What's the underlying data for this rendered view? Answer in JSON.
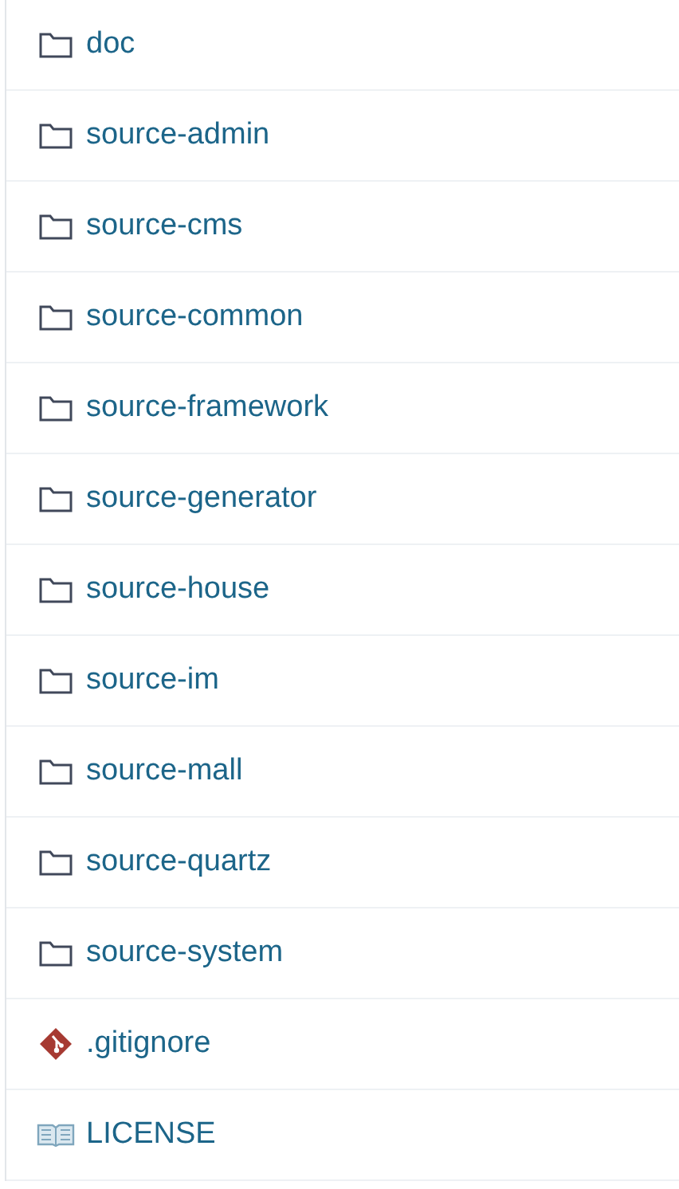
{
  "files": [
    {
      "kind": "folder",
      "name": "doc"
    },
    {
      "kind": "folder",
      "name": "source-admin"
    },
    {
      "kind": "folder",
      "name": "source-cms"
    },
    {
      "kind": "folder",
      "name": "source-common"
    },
    {
      "kind": "folder",
      "name": "source-framework"
    },
    {
      "kind": "folder",
      "name": "source-generator"
    },
    {
      "kind": "folder",
      "name": "source-house"
    },
    {
      "kind": "folder",
      "name": "source-im"
    },
    {
      "kind": "folder",
      "name": "source-mall"
    },
    {
      "kind": "folder",
      "name": "source-quartz"
    },
    {
      "kind": "folder",
      "name": "source-system"
    },
    {
      "kind": "git",
      "name": ".gitignore"
    },
    {
      "kind": "book",
      "name": "LICENSE"
    }
  ]
}
